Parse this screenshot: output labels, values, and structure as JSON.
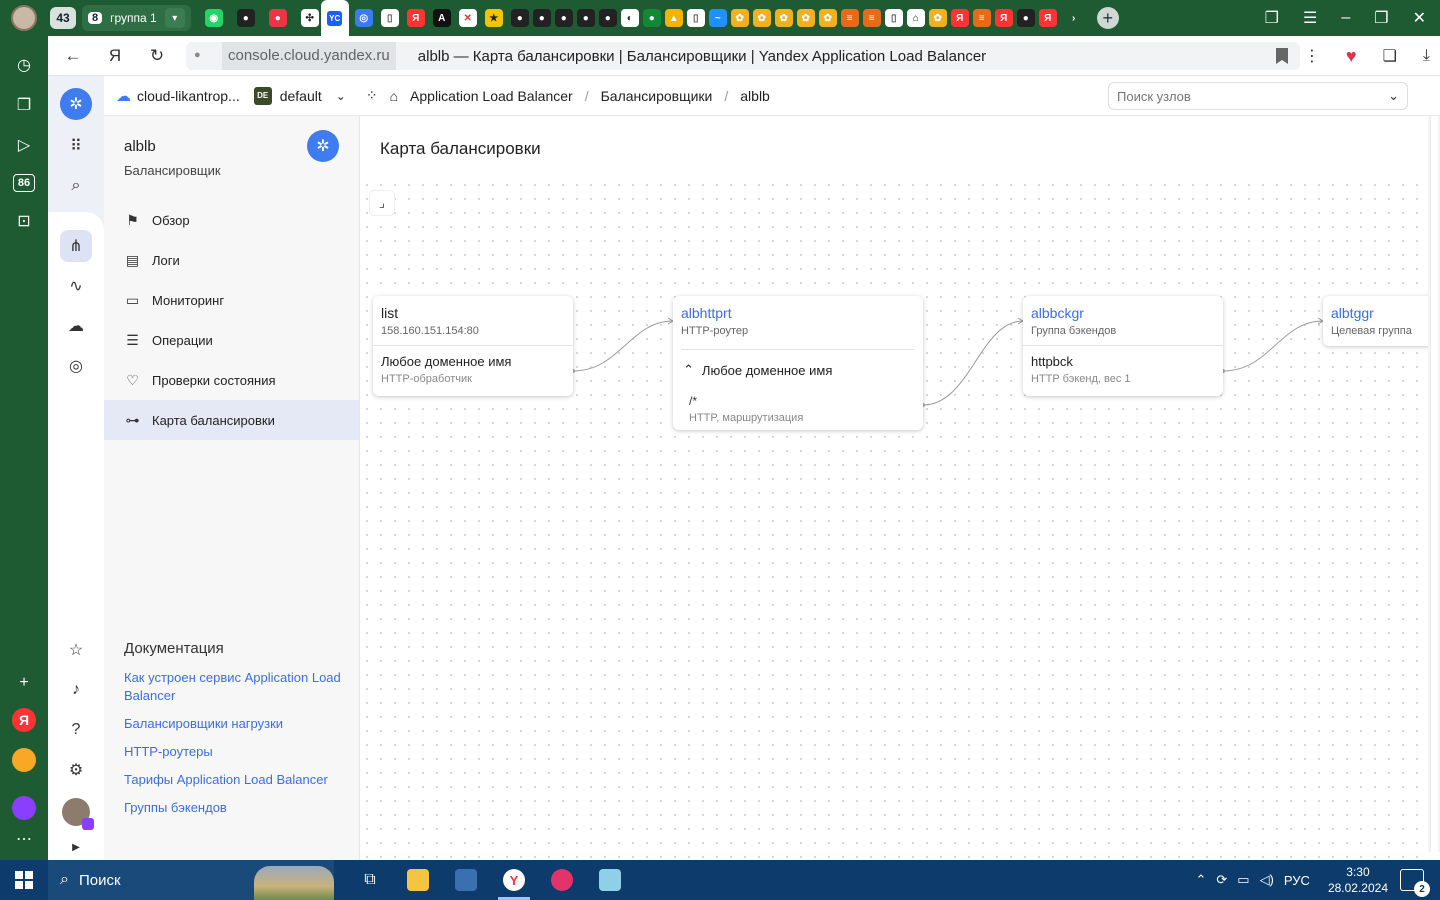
{
  "browser": {
    "tab_count": "43",
    "group_count": "8",
    "group_name": "группа 1",
    "active_tab_badge": "YC",
    "address_host": "console.cloud.yandex.ru",
    "page_title": "alblb — Карта балансировки | Балансировщики | Yandex Application Load Balancer",
    "sidebar_badge": "86"
  },
  "console": {
    "cloud_name": "cloud-likantrop...",
    "folder_badge": "DE",
    "folder_name": "default",
    "breadcrumbs": [
      "Application Load Balancer",
      "Балансировщики",
      "alblb"
    ],
    "search_placeholder": "Поиск узлов"
  },
  "resource": {
    "name": "alblb",
    "type": "Балансировщик"
  },
  "menu": {
    "items": [
      {
        "label": "Обзор",
        "icon": "flag-icon"
      },
      {
        "label": "Логи",
        "icon": "log-icon"
      },
      {
        "label": "Мониторинг",
        "icon": "monitor-icon"
      },
      {
        "label": "Операции",
        "icon": "list-icon"
      },
      {
        "label": "Проверки состояния",
        "icon": "heartbeat-icon"
      },
      {
        "label": "Карта балансировки",
        "icon": "graph-icon"
      }
    ],
    "active_index": 5
  },
  "docs": {
    "heading": "Документация",
    "links": [
      "Как устроен сервис Application Load Balancer",
      "Балансировщики нагрузки",
      "HTTP-роутеры",
      "Тарифы Application Load Balancer",
      "Группы бэкендов"
    ]
  },
  "main": {
    "title": "Карта балансировки"
  },
  "map": {
    "listener": {
      "title": "list",
      "address": "158.160.151.154:80",
      "handler_title": "Любое доменное имя",
      "handler_sub": "HTTP-обработчик"
    },
    "router": {
      "title": "albhttprt",
      "sub": "HTTP-роутер",
      "host_group": "Любое доменное имя",
      "route_path": "/*",
      "route_sub": "HTTP, маршрутизация"
    },
    "backend_group": {
      "title": "albbckgr",
      "sub": "Группа бэкендов",
      "backend_title": "httpbck",
      "backend_sub": "HTTP бэкенд, вес 1"
    },
    "target_group": {
      "title": "albtggr",
      "sub": "Целевая группа"
    }
  },
  "taskbar": {
    "search_label": "Поиск",
    "lang": "РУС",
    "time": "3:30",
    "date": "28.02.2024",
    "notifications": "2"
  },
  "colors": {
    "accent": "#3e7cf0",
    "link": "#3b6ee6",
    "browser_chrome": "#1e5b33",
    "taskbar": "#0d3b6b"
  }
}
